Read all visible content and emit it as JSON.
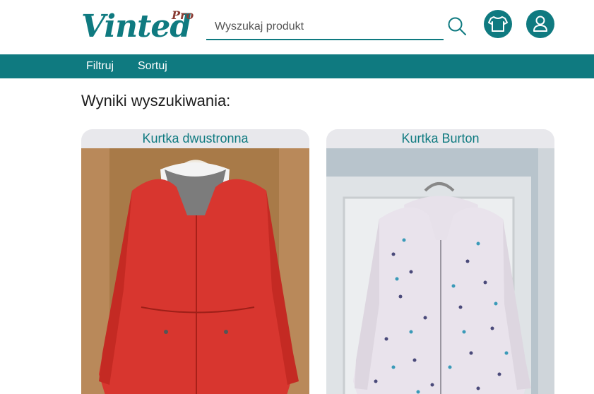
{
  "brand": {
    "name": "Vinted",
    "suffix": "Pro",
    "color": "#0f7a80",
    "accent": "#8a3b32"
  },
  "search": {
    "placeholder": "Wyszukaj produkt",
    "value": ""
  },
  "icons": {
    "search": "search-icon",
    "shirt": "shirt-icon",
    "user": "user-icon"
  },
  "nav": {
    "filter_label": "Filtruj",
    "sort_label": "Sortuj"
  },
  "results": {
    "title": "Wyniki wyszukiwania:",
    "items": [
      {
        "title": "Kurtka dwustronna",
        "image": "red jacket on hanger",
        "image_color": "#d8362f"
      },
      {
        "title": "Kurtka Burton",
        "image": "white polka-dot jacket on hanger",
        "image_color": "#e9e3ec"
      }
    ]
  }
}
